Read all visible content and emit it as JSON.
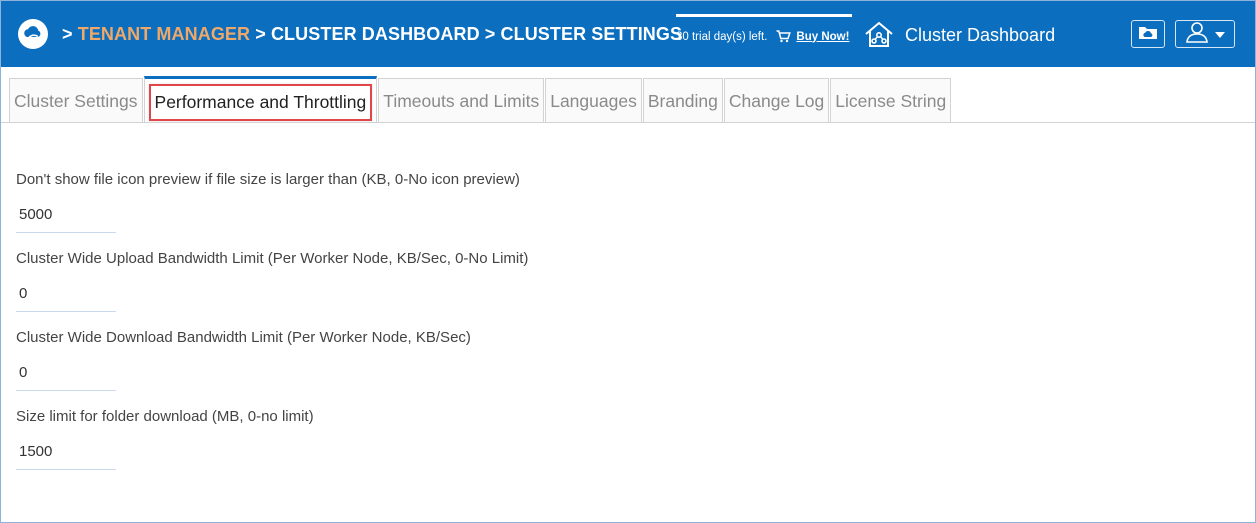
{
  "header": {
    "breadcrumb": {
      "prefix": ">",
      "tenant": "TENANT MANAGER",
      "dashboard": "> CLUSTER DASHBOARD",
      "settings": "> CLUSTER SETTINGS"
    },
    "trial_text": "30 trial day(s) left.",
    "buy_label": "Buy Now!",
    "dashboard_title": "Cluster Dashboard",
    "colors": {
      "bar": "#0b6ebf",
      "tenant": "#f0a868"
    },
    "icons": [
      "cloud-logo-icon",
      "cart-icon",
      "house-network-icon",
      "cloud-folder-icon",
      "user-icon",
      "caret-down-icon"
    ]
  },
  "tabs": [
    {
      "label": "Cluster Settings",
      "active": false
    },
    {
      "label": "Performance and Throttling",
      "active": true
    },
    {
      "label": "Timeouts and Limits",
      "active": false
    },
    {
      "label": "Languages",
      "active": false
    },
    {
      "label": "Branding",
      "active": false
    },
    {
      "label": "Change Log",
      "active": false
    },
    {
      "label": "License String",
      "active": false
    }
  ],
  "fields": [
    {
      "label": "Don't show file icon preview if file size is larger than (KB, 0-No icon preview)",
      "value": "5000"
    },
    {
      "label": "Cluster Wide Upload Bandwidth Limit (Per Worker Node, KB/Sec, 0-No Limit)",
      "value": "0"
    },
    {
      "label": "Cluster Wide Download Bandwidth Limit (Per Worker Node, KB/Sec)",
      "value": "0"
    },
    {
      "label": "Size limit for folder download (MB, 0-no limit)",
      "value": "1500"
    }
  ]
}
